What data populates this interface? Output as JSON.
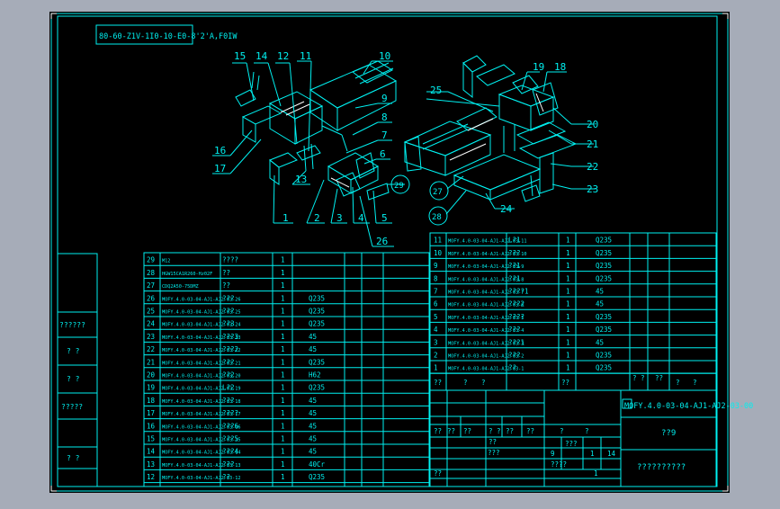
{
  "colors": {
    "background": "#a6acb8",
    "sheet": "#000000",
    "line": "#00f0f0",
    "text": "#00f0f0",
    "highlight": "#ffffff"
  },
  "title_code_box": "80-60-Z1V-1I0-10-E0-8'2'A,F0IW",
  "callouts": [
    "1",
    "2",
    "3",
    "4",
    "5",
    "6",
    "7",
    "8",
    "9",
    "10",
    "11",
    "12",
    "13",
    "14",
    "15",
    "16",
    "17",
    "18",
    "19",
    "20",
    "21",
    "22",
    "23",
    "24",
    "25",
    "26",
    "27",
    "28",
    "29"
  ],
  "left_side_labels": [
    "??????",
    "? ?",
    "? ?",
    "?????",
    "? ?"
  ],
  "bom_left": [
    {
      "no": "29",
      "code": "M12",
      "name": "????",
      "qty": "1",
      "mat": ""
    },
    {
      "no": "28",
      "code": "HGW15CA1R260-Hz02F",
      "name": "??",
      "qty": "1",
      "mat": ""
    },
    {
      "no": "27",
      "code": "CDQ2A50-75DMZ",
      "name": "??",
      "qty": "1",
      "mat": ""
    },
    {
      "no": "26",
      "code": "MOFY.4.0-03-04-AJ1-AJ2-03-26",
      "name": "???",
      "qty": "1",
      "mat": "Q235"
    },
    {
      "no": "25",
      "code": "MOFY.4.0-03-04-AJ1-AJ2-03-25",
      "name": "???",
      "qty": "1",
      "mat": "Q235"
    },
    {
      "no": "24",
      "code": "MOFY.4.0-03-04-AJ1-AJ2-03-24",
      "name": "??3",
      "qty": "1",
      "mat": "Q235"
    },
    {
      "no": "23",
      "code": "MOFY.4.0-03-04-AJ1-AJ2-03-23",
      "name": "???3",
      "qty": "1",
      "mat": "45"
    },
    {
      "no": "22",
      "code": "MOFY.4.0-03-04-AJ1-AJ2-03-22",
      "name": "???2",
      "qty": "1",
      "mat": "45"
    },
    {
      "no": "21",
      "code": "MOFY.4.0-03-04-AJ1-AJ2-03-21",
      "name": "???",
      "qty": "1",
      "mat": "Q235"
    },
    {
      "no": "20",
      "code": "MOFY.4.0-03-04-AJ1-AJ2-03-20",
      "name": "??2",
      "qty": "1",
      "mat": "H62"
    },
    {
      "no": "19",
      "code": "MOFY.4.0-03-04-AJ1-AJ2-03-19",
      "name": "L?2",
      "qty": "1",
      "mat": "Q235"
    },
    {
      "no": "18",
      "code": "MOFY.4.0-03-04-AJ1-AJ2-03-18",
      "name": "???",
      "qty": "1",
      "mat": "45"
    },
    {
      "no": "17",
      "code": "MOFY.4.0-03-04-AJ1-AJ2-03-17",
      "name": "????",
      "qty": "1",
      "mat": "45"
    },
    {
      "no": "16",
      "code": "MOFY.4.0-03-04-AJ1-AJ2-03-16",
      "name": "???6",
      "qty": "1",
      "mat": "45"
    },
    {
      "no": "15",
      "code": "MOFY.4.0-03-04-AJ1-AJ2-03-15",
      "name": "???5",
      "qty": "1",
      "mat": "45"
    },
    {
      "no": "14",
      "code": "MOFY.4.0-03-04-AJ1-AJ2-03-14",
      "name": "???4",
      "qty": "1",
      "mat": "45"
    },
    {
      "no": "13",
      "code": "MOFY.4.0-03-04-AJ1-AJ2-03-13",
      "name": "???",
      "qty": "1",
      "mat": "40Cr"
    },
    {
      "no": "12",
      "code": "MOFY.4.0-03-04-AJ1-AJ2-03-12",
      "name": "??",
      "qty": "1",
      "mat": "Q235"
    }
  ],
  "bom_right": [
    {
      "no": "11",
      "code": "MOFY.4.0-03-04-AJ1-AJ2-03-11",
      "name": "L?1",
      "qty": "1",
      "mat": "Q235"
    },
    {
      "no": "10",
      "code": "MOFY.4.0-03-04-AJ1-AJ2-03-10",
      "name": "???",
      "qty": "1",
      "mat": "Q235"
    },
    {
      "no": "9",
      "code": "MOFY.4.0-03-04-AJ1-AJ2-03-9",
      "name": "??1",
      "qty": "1",
      "mat": "Q235"
    },
    {
      "no": "8",
      "code": "MOFY.4.0-03-04-AJ1-AJ2-03-8",
      "name": "??1",
      "qty": "1",
      "mat": "Q235"
    },
    {
      "no": "7",
      "code": "MOFY.4.0-03-04-AJ1-AJ2-03-7",
      "name": "????1",
      "qty": "1",
      "mat": "45"
    },
    {
      "no": "6",
      "code": "MOFY.4.0-03-04-AJ1-AJ2-03-6",
      "name": "???2",
      "qty": "1",
      "mat": "45"
    },
    {
      "no": "5",
      "code": "MOFY.4.0-03-04-AJ1-AJ2-03-5",
      "name": "????",
      "qty": "1",
      "mat": "Q235"
    },
    {
      "no": "4",
      "code": "MOFY.4.0-03-04-AJ1-AJ2-03-4",
      "name": "???",
      "qty": "1",
      "mat": "Q235"
    },
    {
      "no": "3",
      "code": "MOFY.4.0-03-04-AJ1-AJ2-03-3",
      "name": "???1",
      "qty": "1",
      "mat": "45"
    },
    {
      "no": "2",
      "code": "MOFY.4.0-03-04-AJ1-AJ2-03-2",
      "name": "???",
      "qty": "1",
      "mat": "Q235"
    },
    {
      "no": "1",
      "code": "MOFY.4.0-03-04-AJ1-AJ2-03-1",
      "name": "??",
      "qty": "1",
      "mat": "Q235"
    }
  ],
  "bom_header": [
    "??",
    "?",
    "?",
    "??",
    "? ?",
    "??",
    "?",
    "?"
  ],
  "title_block": {
    "drawing_no": "MOFY.4.0-03-04-AJ1-AJ2-03-00",
    "part_name": "??9",
    "company": "??????????",
    "sheet_total": "1",
    "sheet_no": "14",
    "cell_a": "??",
    "cell_b": "??",
    "cell_c": "??",
    "cell_d": "? ?",
    "cell_e": "??",
    "cell_f": "??",
    "cell_g": "???",
    "cell_h": "?",
    "cell_i": "?",
    "cell_j": "???",
    "cell_k": "????",
    "cell_l": "1",
    "cell_m": "9",
    "cell_n": "??",
    "cell_o": "??"
  }
}
